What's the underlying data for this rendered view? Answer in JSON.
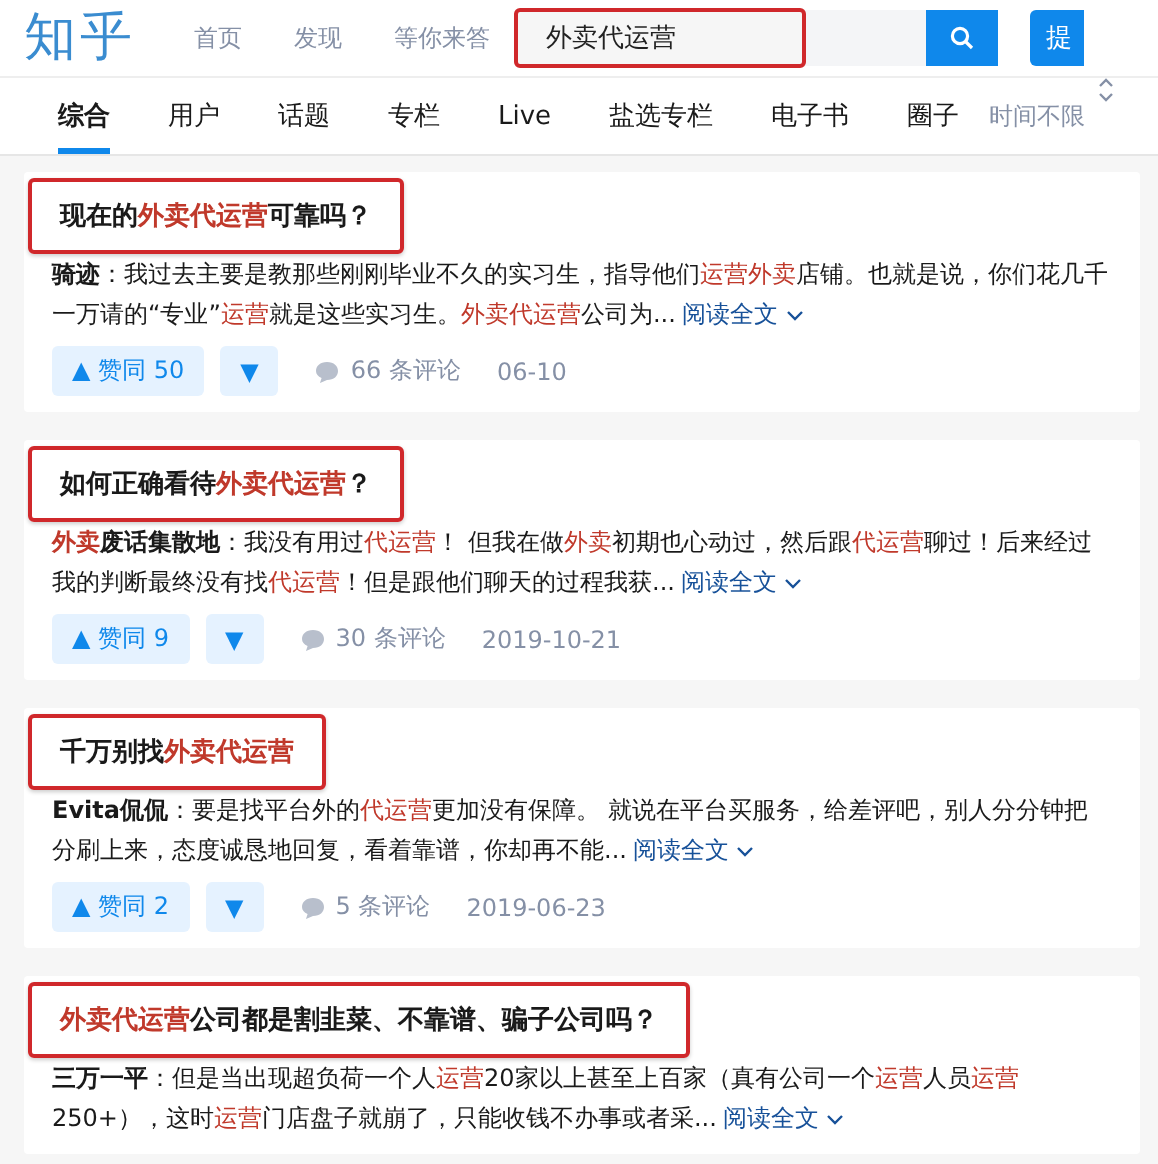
{
  "header": {
    "logo": "知乎",
    "nav": [
      {
        "label": "首页"
      },
      {
        "label": "发现"
      },
      {
        "label": "等你来答"
      }
    ],
    "search": {
      "value": "外卖代运营",
      "annotated": true
    },
    "ask_button": "提"
  },
  "tabs": [
    {
      "label": "综合",
      "selected": true
    },
    {
      "label": "用户",
      "selected": false
    },
    {
      "label": "话题",
      "selected": false
    },
    {
      "label": "专栏",
      "selected": false
    },
    {
      "label": "Live",
      "selected": false
    },
    {
      "label": "盐选专栏",
      "selected": false
    },
    {
      "label": "电子书",
      "selected": false
    },
    {
      "label": "圈子",
      "selected": false
    }
  ],
  "time_filter": "时间不限",
  "results": [
    {
      "title": [
        {
          "text": "现在的",
          "kind": "plain"
        },
        {
          "text": "外卖代运营",
          "kind": "hit"
        },
        {
          "text": "可靠吗？",
          "kind": "plain"
        }
      ],
      "annotated": true,
      "excerpt": [
        {
          "text": "骑迹",
          "kind": "author"
        },
        {
          "text": "：我过去主要是教那些刚刚毕业不久的实习生，指导他们",
          "kind": "plain"
        },
        {
          "text": "运营外卖",
          "kind": "hit"
        },
        {
          "text": "店铺。也就是说，你们花几千一万请的“专业”",
          "kind": "plain"
        },
        {
          "text": "运营",
          "kind": "hit"
        },
        {
          "text": "就是这些实习生。",
          "kind": "plain"
        },
        {
          "text": "外卖代运营",
          "kind": "hit"
        },
        {
          "text": "公司为...",
          "kind": "plain"
        }
      ],
      "read_more": "阅读全文",
      "upvote": "▲ 赞同 50",
      "downvote": "▼",
      "comments": "66 条评论",
      "date": "06-10"
    },
    {
      "title": [
        {
          "text": "如何正确看待",
          "kind": "plain"
        },
        {
          "text": "外卖代运营",
          "kind": "hit"
        },
        {
          "text": "？",
          "kind": "plain"
        }
      ],
      "annotated": true,
      "excerpt": [
        {
          "text": "外卖",
          "kind": "author-hit"
        },
        {
          "text": "废话集散地",
          "kind": "author"
        },
        {
          "text": "：我没有用过",
          "kind": "plain"
        },
        {
          "text": "代运营",
          "kind": "hit"
        },
        {
          "text": "！ 但我在做",
          "kind": "plain"
        },
        {
          "text": "外卖",
          "kind": "hit"
        },
        {
          "text": "初期也心动过，然后跟",
          "kind": "plain"
        },
        {
          "text": "代运营",
          "kind": "hit"
        },
        {
          "text": "聊过！后来经过我的判断最终没有找",
          "kind": "plain"
        },
        {
          "text": "代运营",
          "kind": "hit"
        },
        {
          "text": "！但是跟他们聊天的过程我获...",
          "kind": "plain"
        }
      ],
      "read_more": "阅读全文",
      "upvote": "▲ 赞同 9",
      "downvote": "▼",
      "comments": "30 条评论",
      "date": "2019-10-21"
    },
    {
      "title": [
        {
          "text": "千万别找",
          "kind": "plain"
        },
        {
          "text": "外卖代运营",
          "kind": "hit"
        }
      ],
      "annotated": true,
      "excerpt": [
        {
          "text": "Evita侃侃",
          "kind": "author"
        },
        {
          "text": "：要是找平台外的",
          "kind": "plain"
        },
        {
          "text": "代运营",
          "kind": "hit"
        },
        {
          "text": "更加没有保障。 就说在平台买服务，给差评吧，别人分分钟把分刷上来，态度诚恳地回复，看着靠谱，你却再不能...",
          "kind": "plain"
        }
      ],
      "read_more": "阅读全文",
      "upvote": "▲ 赞同 2",
      "downvote": "▼",
      "comments": "5 条评论",
      "date": "2019-06-23"
    },
    {
      "title": [
        {
          "text": "外卖代运营",
          "kind": "hit"
        },
        {
          "text": "公司都是割韭菜、不靠谱、骗子公司吗？",
          "kind": "plain"
        }
      ],
      "annotated": true,
      "excerpt": [
        {
          "text": "三万一平",
          "kind": "author"
        },
        {
          "text": "：但是当出现超负荷一个人",
          "kind": "plain"
        },
        {
          "text": "运营",
          "kind": "hit"
        },
        {
          "text": "20家以上甚至上百家（真有公司一个",
          "kind": "plain"
        },
        {
          "text": "运营",
          "kind": "hit"
        },
        {
          "text": "人员",
          "kind": "plain"
        },
        {
          "text": "运营",
          "kind": "hit"
        },
        {
          "text": "250+），这时",
          "kind": "plain"
        },
        {
          "text": "运营",
          "kind": "hit"
        },
        {
          "text": "门店盘子就崩了，只能收钱不办事或者采...",
          "kind": "plain"
        }
      ],
      "read_more": "阅读全文"
    }
  ]
}
